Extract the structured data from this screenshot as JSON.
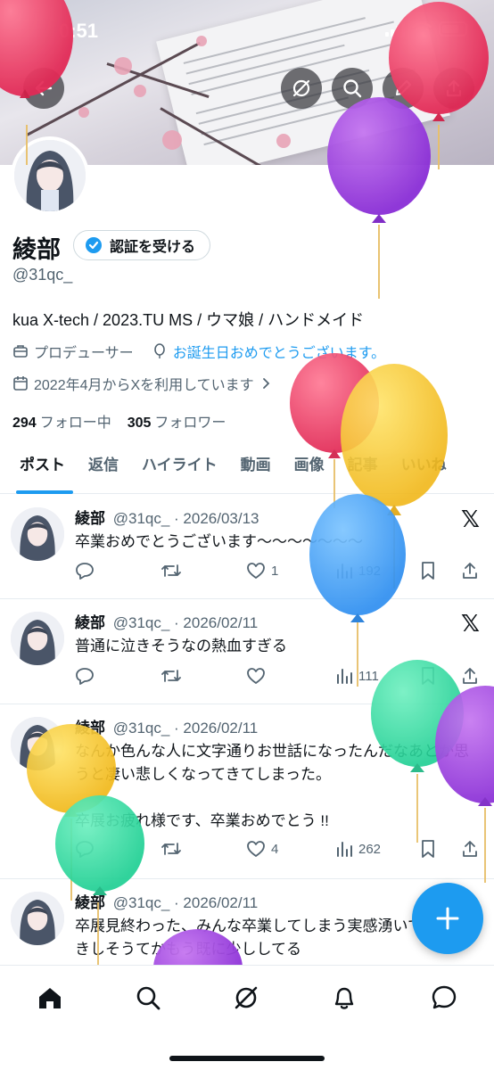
{
  "status_bar": {
    "time": "0:51"
  },
  "header": {
    "back_icon": "back-arrow-icon",
    "actions": [
      "grok-icon",
      "search-icon",
      "edit-icon",
      "share-icon"
    ]
  },
  "profile": {
    "name": "綾部",
    "verify_label": "認証を受ける",
    "handle": "@31qc_",
    "bio": "kua X-tech / 2023.TU MS / ウマ娘 / ハンドメイド",
    "job": "プロデューサー",
    "birthday_text": "お誕生日おめでとうございます。",
    "joined": "2022年4月からXを利用しています",
    "following_count": "294",
    "following_label": "フォロー中",
    "followers_count": "305",
    "followers_label": "フォロワー"
  },
  "tabs": [
    "ポスト",
    "返信",
    "ハイライト",
    "動画",
    "画像",
    "記事",
    "いいね"
  ],
  "posts": [
    {
      "name": "綾部",
      "handle": "@31qc_",
      "date": "· 2026/03/13",
      "text": "卒業おめでとうございます〜〜〜〜〜〜〜",
      "likes": "1",
      "views": "192"
    },
    {
      "name": "綾部",
      "handle": "@31qc_",
      "date": "· 2026/02/11",
      "text": "普通に泣きそうなの熱血すぎる",
      "likes": "",
      "views": "111"
    },
    {
      "name": "綾部",
      "handle": "@31qc_",
      "date": "· 2026/02/11",
      "text": "なんか色んな人に文字通りお世話になったんだなあとか思うと凄い悲しくなってきてしまった。\n\n卒展お疲れ様です、卒業おめでとう !!",
      "likes": "4",
      "views": "262"
    },
    {
      "name": "綾部",
      "handle": "@31qc_",
      "date": "· 2026/02/11",
      "text": "卒展見終わった、みんな卒業してしまう実感湧いてガチ泣きしそうてかもう既に少ししてる"
    }
  ],
  "nav": [
    "home-icon",
    "search-icon",
    "grok-icon",
    "notifications-icon",
    "messages-icon"
  ],
  "colors": {
    "accent": "#1d9bf0",
    "text": "#0f1419",
    "muted": "#536471"
  }
}
